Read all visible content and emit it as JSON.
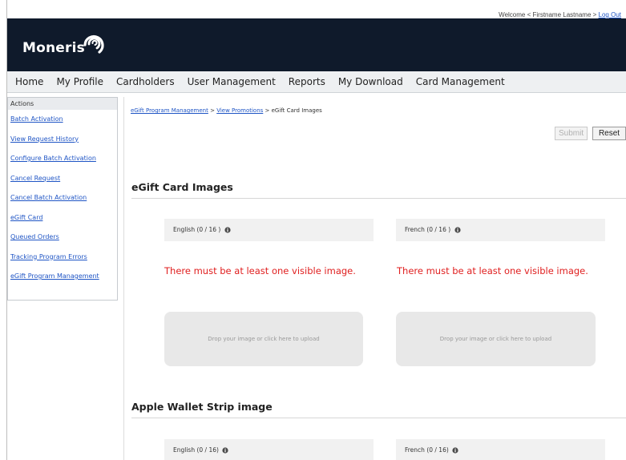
{
  "header": {
    "welcome_text": "Welcome < Firstname Lastname > ",
    "logout_label": "Log Out",
    "brand_name": "Moneris"
  },
  "nav": {
    "items": [
      "Home",
      "My Profile",
      "Cardholders",
      "User Management",
      "Reports",
      "My Download",
      "Card Management"
    ]
  },
  "sidebar": {
    "heading": "Actions",
    "items": [
      "Batch Activation",
      "View Request History",
      "Configure Batch Activation",
      "Cancel Request",
      "Cancel Batch Activation",
      "eGift Card",
      "Queued Orders",
      "Tracking Program Errors",
      "eGift Program Management"
    ]
  },
  "breadcrumb": {
    "crumb1": "eGift Program Management",
    "sep1": " > ",
    "crumb2": "View Promotions",
    "sep2": " > ",
    "current": "eGift Card Images"
  },
  "toolbar": {
    "submit_label": "Submit",
    "reset_label": "Reset"
  },
  "egift_section": {
    "title": "eGift Card Images",
    "english_label": "English (0 / 16 )",
    "french_label": "French (0 / 16 )",
    "english_error": "There must be at least one visible image.",
    "french_error": "There must be at least one visible image.",
    "english_drop": "Drop your image or click here to upload",
    "french_drop": "Drop your image or click here to upload"
  },
  "wallet_section": {
    "title": "Apple Wallet Strip image",
    "english_label": "English (0 / 16)",
    "french_label": "French (0 / 16)"
  },
  "colors": {
    "brand_bar": "#0f1a2b",
    "link": "#1f55c5",
    "error": "#e02020"
  }
}
